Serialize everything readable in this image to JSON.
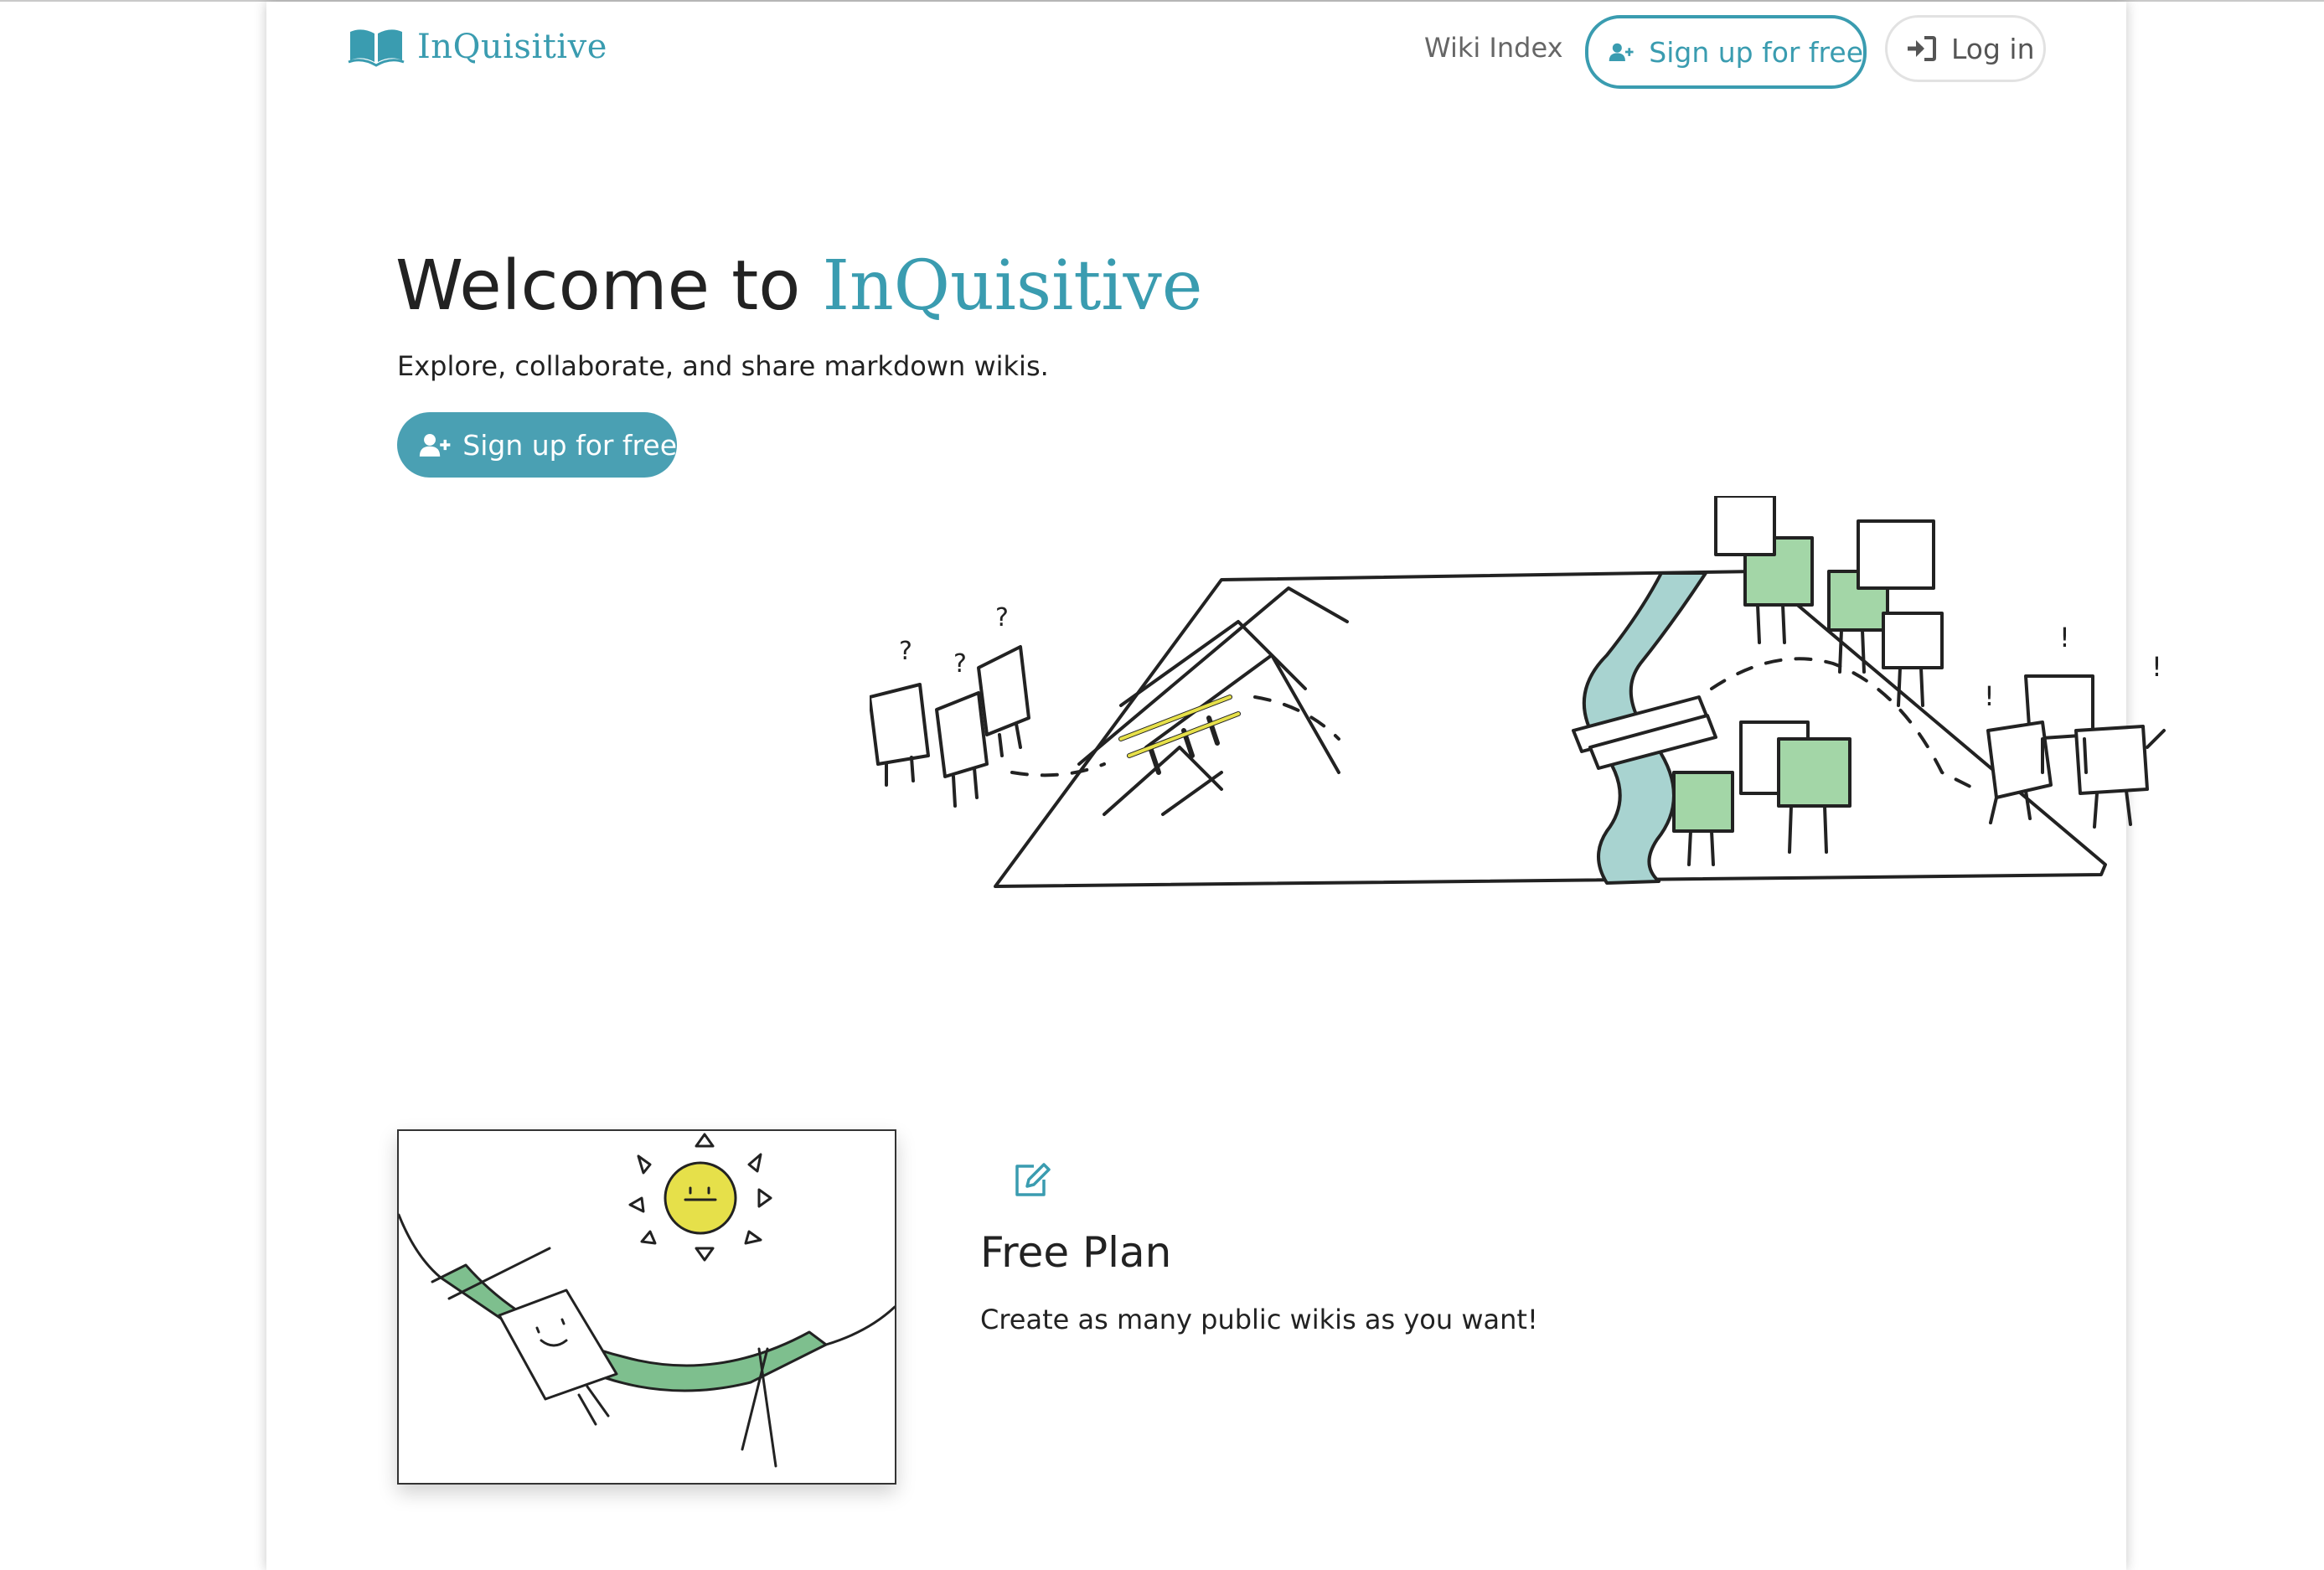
{
  "brand": {
    "name": "InQuisitive",
    "color": "#3a9cb0"
  },
  "nav": {
    "wiki_index": "Wiki Index",
    "signup": "Sign up for free",
    "login": "Log in"
  },
  "hero": {
    "title_prefix": "Welcome to",
    "title_brand": "InQuisitive",
    "subtitle": "Explore, collaborate, and share markdown wikis.",
    "cta": "Sign up for free"
  },
  "feature": {
    "icon": "edit-icon",
    "title": "Free Plan",
    "description": "Create as many public wikis as you want!"
  },
  "illustrations": {
    "hero_question_marks": [
      "?",
      "?",
      "?"
    ],
    "hero_exclamations": [
      "!",
      "!",
      "!"
    ]
  },
  "colors": {
    "accent": "#3a9cb0",
    "button_fill": "#4aa0b3",
    "river": "#a8d3d0",
    "green_block": "#a3d6a7",
    "yellow": "#e6e04a",
    "hammock": "#7ebf8e"
  }
}
